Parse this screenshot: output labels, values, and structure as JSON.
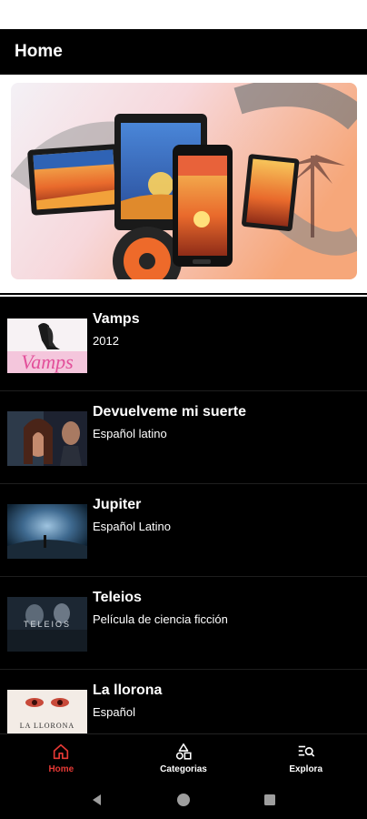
{
  "app_bar": {
    "title": "Home"
  },
  "movies": [
    {
      "title": "Vamps",
      "subtitle": "2012"
    },
    {
      "title": "Devuelveme mi suerte",
      "subtitle": "Español latino"
    },
    {
      "title": "Jupiter",
      "subtitle": "Español Latino"
    },
    {
      "title": "Teleios",
      "subtitle": "Película de ciencia ficción"
    },
    {
      "title": "La llorona",
      "subtitle": "Español"
    }
  ],
  "thumb_text": {
    "vamps": "Vamps",
    "teleios": "TELEIOS",
    "llorona": "LA LLORONA"
  },
  "bottom_nav": [
    {
      "label": "Home",
      "icon": "home-icon",
      "active": true
    },
    {
      "label": "Categorias",
      "icon": "categories-icon",
      "active": false
    },
    {
      "label": "Explora",
      "icon": "explore-icon",
      "active": false
    }
  ],
  "colors": {
    "accent": "#e53935",
    "background": "#000000"
  }
}
